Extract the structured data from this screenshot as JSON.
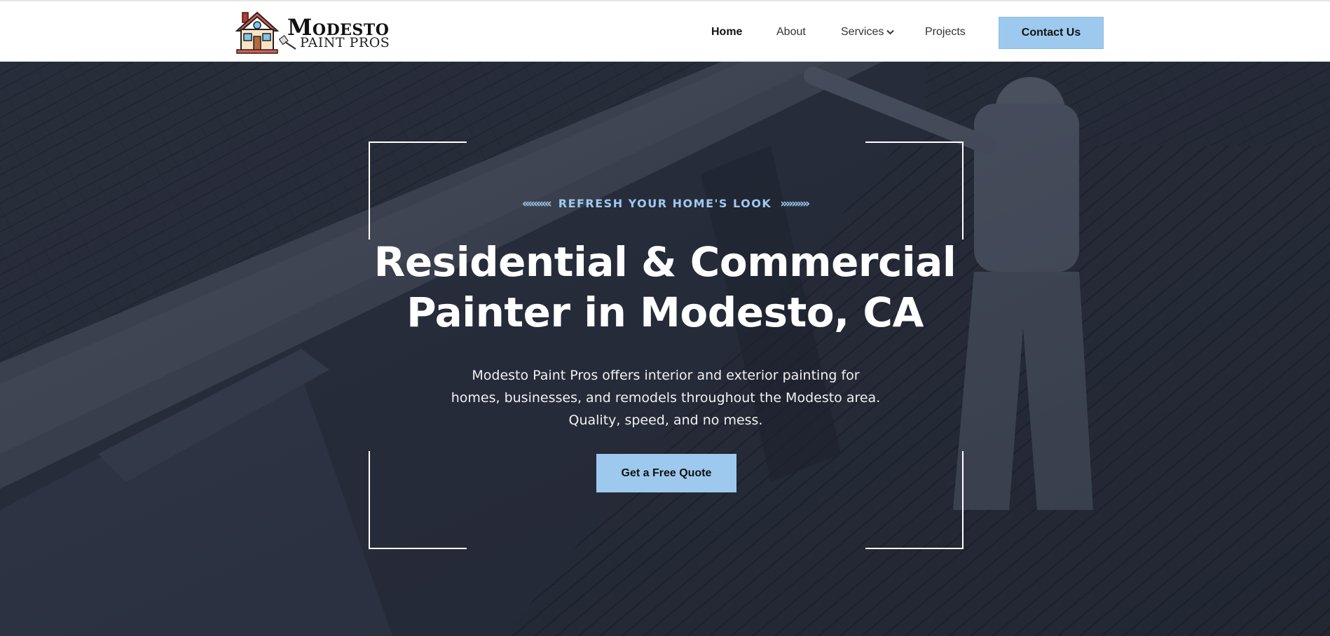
{
  "brand": {
    "name_line1": "Modesto",
    "name_line2": "PAINT PROS",
    "logo_icon": "house-icon",
    "accent_color": "#9ec9ee"
  },
  "nav": {
    "items": [
      {
        "label": "Home",
        "active": true
      },
      {
        "label": "About",
        "active": false
      },
      {
        "label": "Services",
        "active": false,
        "has_dropdown": true
      },
      {
        "label": "Projects",
        "active": false
      }
    ],
    "cta_label": "Contact Us"
  },
  "hero": {
    "eyebrow": "REFRESH YOUR HOME'S LOOK",
    "eyebrow_left_arrows": "«««««",
    "eyebrow_right_arrows": "»»»»»",
    "title_line1": "Residential & Commercial",
    "title_line2": "Painter in Modesto, CA",
    "description": "Modesto Paint Pros offers interior and exterior painting for homes, businesses, and remodels throughout the Modesto area. Quality, speed, and no mess.",
    "cta_label": "Get a Free Quote"
  }
}
